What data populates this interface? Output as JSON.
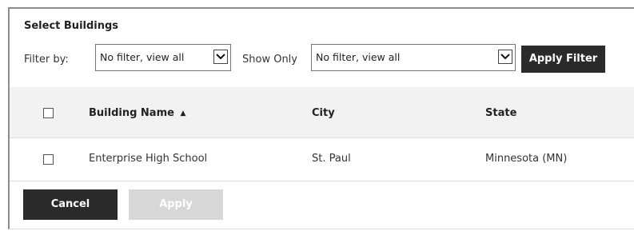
{
  "dialog": {
    "title": "Select Buildings"
  },
  "filters": {
    "filter_by_label": "Filter by:",
    "filter_by_value": "No filter, view all",
    "show_only_label": "Show Only",
    "show_only_value": "No filter, view all",
    "apply_filter_label": "Apply Filter"
  },
  "table": {
    "columns": [
      "Building Name",
      "City",
      "State"
    ],
    "sort_indicator": "▲",
    "rows": [
      {
        "building_name": "Enterprise High School",
        "city": "St. Paul",
        "state": "Minnesota (MN)",
        "checked": false
      }
    ]
  },
  "actions": {
    "cancel_label": "Cancel",
    "apply_label": "Apply"
  },
  "colors": {
    "dark_button": "#2b2b2b",
    "disabled_button": "#d7d7d7",
    "header_bg": "#f2f2f2"
  }
}
